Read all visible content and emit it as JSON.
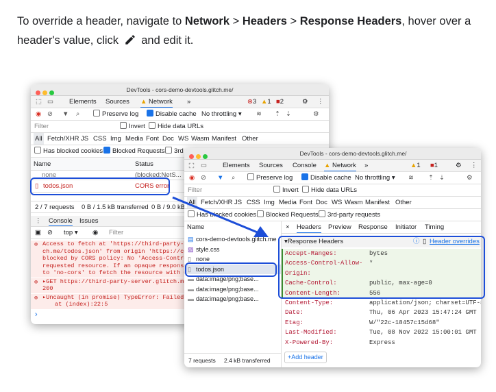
{
  "intro": {
    "p1": "To override a header, navigate to ",
    "b1": "Network",
    "sep1": " > ",
    "b2": "Headers",
    "sep2": " > ",
    "b3": "Response Headers",
    "p2": ", hover over a",
    "p3": "header's value, click ",
    "p4": " and edit it.",
    "pencil_icon": "pencil-icon"
  },
  "back": {
    "title": "DevTools - cors-demo-devtools.glitch.me/",
    "tabs": [
      "Elements",
      "Sources",
      "Network",
      "»"
    ],
    "badges": {
      "errors": "3",
      "warnings": "1",
      "issues": "2"
    },
    "toolbar": {
      "preserve_log": "Preserve log",
      "disable_cache": "Disable cache",
      "throttle": "No throttling"
    },
    "filter_placeholder": "Filter",
    "invert": "Invert",
    "hide_data": "Hide data URLs",
    "types": [
      "All",
      "Fetch/XHR",
      "JS",
      "CSS",
      "Img",
      "Media",
      "Font",
      "Doc",
      "WS",
      "Wasm",
      "Manifest",
      "Other"
    ],
    "blocked_cookies": "Has blocked cookies",
    "blocked_requests": "Blocked Requests",
    "third": "3rd",
    "columns": {
      "name": "Name",
      "status": "Status"
    },
    "rows": [
      {
        "name": "none",
        "status": "(blocked:NetS..."
      },
      {
        "name": "todos.json",
        "status": "CORS error"
      }
    ],
    "summary": {
      "requests": "2 / 7 requests",
      "transferred": "0 B / 1.5 kB transferred",
      "resources": "0 B / 9.0 kB"
    },
    "drawer_tabs": [
      "Console",
      "Issues"
    ],
    "console_context": "top",
    "console_filter": "Filter",
    "console_lines": [
      "Access to fetch at 'https://third-party-serv",
      "ch.me/todos.json' from origin 'https://cors-",
      "blocked by CORS policy: No 'Access-Control-A",
      "requested resource. If an opaque response se",
      "to 'no-cors' to fetch the resource with CORS"
    ],
    "get_line": "▸GET https://third-party-server.glitch.me/t",
    "get_status": "200",
    "uncaught_1": "▸Uncaught (in promise) TypeError: Failed t",
    "uncaught_2": "at (index):22:5",
    "prompt": "›"
  },
  "front": {
    "title": "DevTools - cors-demo-devtools.glitch.me/",
    "tabs": [
      "Elements",
      "Sources",
      "Console",
      "Network",
      "»"
    ],
    "badges": {
      "warnings": "1",
      "issues": "1"
    },
    "toolbar": {
      "preserve_log": "Preserve log",
      "disable_cache": "Disable cache",
      "throttle": "No throttling"
    },
    "filter_placeholder": "Filter",
    "invert": "Invert",
    "hide_data": "Hide data URLs",
    "types": [
      "All",
      "Fetch/XHR",
      "JS",
      "CSS",
      "Img",
      "Media",
      "Font",
      "Doc",
      "WS",
      "Wasm",
      "Manifest",
      "Other"
    ],
    "blocked_cookies": "Has blocked cookies",
    "blocked_requests": "Blocked Requests",
    "third_party": "3rd-party requests",
    "name_col": "Name",
    "requests": [
      "cors-demo-devtools.glitch.me",
      "style.css",
      "none",
      "todos.json",
      "data:image/png;base...",
      "data:image/png;base...",
      "data:image/png;base..."
    ],
    "footer": {
      "requests": "7 requests",
      "transferred": "2.4 kB transferred"
    },
    "detail_tabs": [
      "×",
      "Headers",
      "Preview",
      "Response",
      "Initiator",
      "Timing"
    ],
    "section": "▾Response Headers",
    "header_overrides": "Header overrides",
    "headers": [
      {
        "k": "Accept-Ranges:",
        "v": "bytes"
      },
      {
        "k": "Access-Control-Allow-",
        "v": "*"
      },
      {
        "k": "Origin:",
        "v": ""
      },
      {
        "k": "Cache-Control:",
        "v": "public, max-age=0"
      },
      {
        "k": "Content-Length:",
        "v": "556"
      },
      {
        "k": "Content-Type:",
        "v": "application/json; charset=UTF-8"
      },
      {
        "k": "Date:",
        "v": "Thu, 06 Apr 2023 15:47:24 GMT"
      },
      {
        "k": "Etag:",
        "v": "W/\"22c-18457c15d68\""
      },
      {
        "k": "Last-Modified:",
        "v": "Tue, 08 Nov 2022 15:00:01 GMT"
      },
      {
        "k": "X-Powered-By:",
        "v": "Express"
      }
    ],
    "add_header": "+Add header"
  },
  "colors": {
    "highlight": "#1d4ed8",
    "error": "#c5221f",
    "accent": "#1a73e8"
  }
}
